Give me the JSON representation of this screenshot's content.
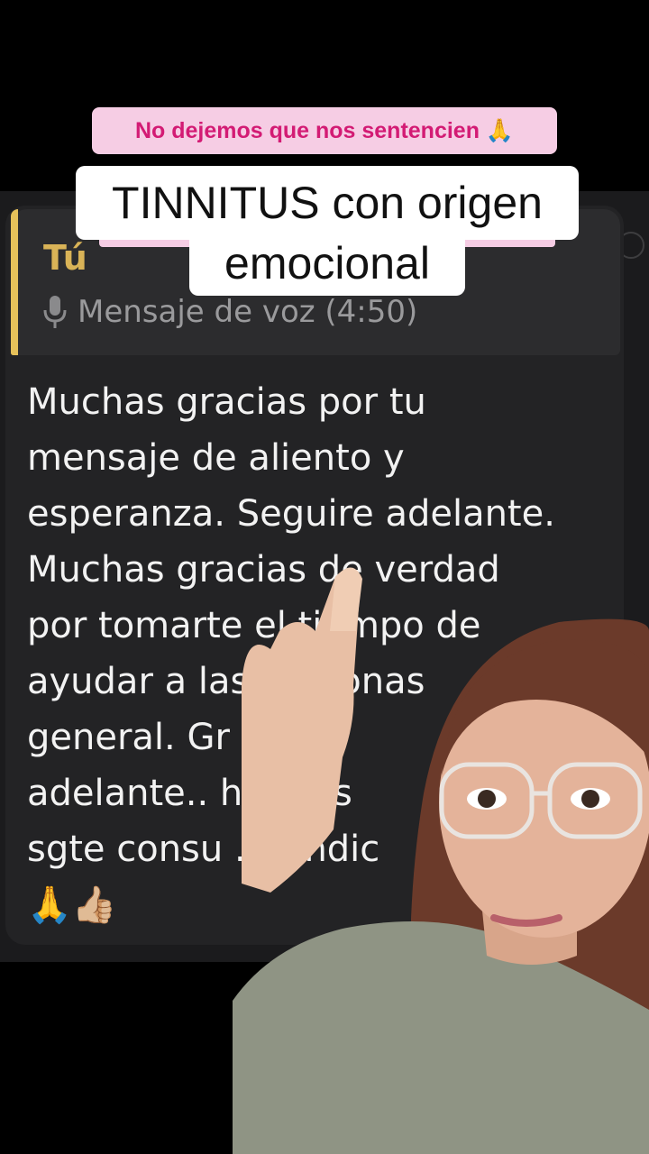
{
  "captions": {
    "top": "No dejemos que nos sentencien 🙏",
    "main_line1": "TINNITUS con origen",
    "main_line2": "emocional"
  },
  "reply": {
    "author": "Tú",
    "voice_label": "Mensaje de voz (4:50)"
  },
  "message": {
    "text": "Muchas gracias por tu\nmensaje de aliento y\nesperanza. Seguire adelante.\nMuchas gracias de verdad\npor tomarte el tiempo de\nayudar a las personas\ngeneral. Gr     ... Se\nadelante.. h   amos\nsgte consu   . Bendic\n🙏👍🏼"
  },
  "colors": {
    "accent_pink": "#d31b74",
    "caption_pink_bg": "#f6cde4",
    "reply_bar": "#e6c15a"
  }
}
